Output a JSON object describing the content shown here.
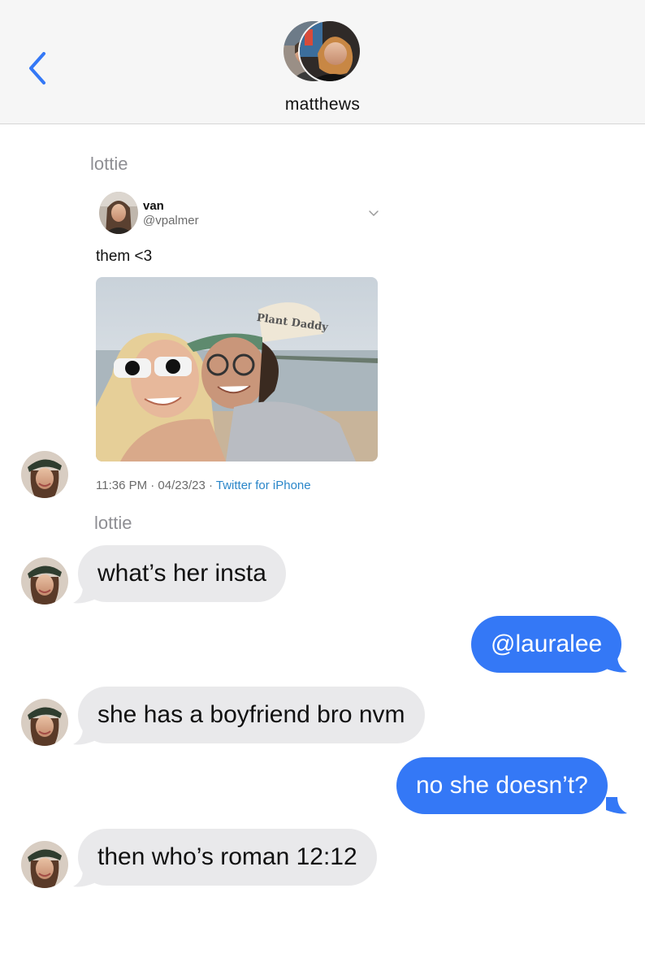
{
  "header": {
    "title": "matthews",
    "back_icon": "chevron-left-icon",
    "accent_color": "#3478f6"
  },
  "tweet_card": {
    "sender": "lottie",
    "display_name": "van",
    "handle": "@vpalmer",
    "text": "them <3",
    "photo_caption_hat": "Plant Daddy",
    "timestamp": "11:36 PM · 04/23/23 · ",
    "source": "Twitter for iPhone",
    "menu_icon": "chevron-down-icon"
  },
  "messages": [
    {
      "sender": "lottie",
      "direction": "incoming",
      "text": "what’s her insta"
    },
    {
      "direction": "outgoing",
      "text": "@lauralee"
    },
    {
      "direction": "incoming",
      "text": "she has a boyfriend bro nvm"
    },
    {
      "direction": "outgoing",
      "text": "no she doesn’t?"
    },
    {
      "direction": "incoming",
      "text": "then who’s roman 12:12"
    }
  ],
  "colors": {
    "incoming_bubble": "#e9e9eb",
    "outgoing_bubble": "#3478f6",
    "header_bg": "#f6f6f6"
  }
}
